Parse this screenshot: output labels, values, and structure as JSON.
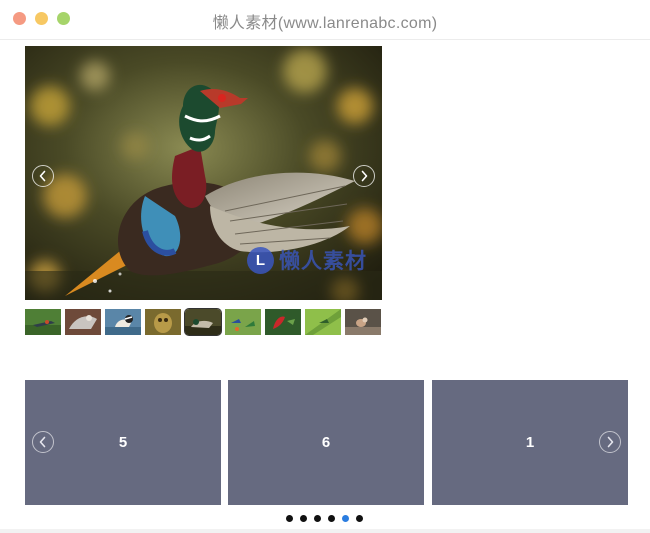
{
  "window": {
    "title": "懒人素材(www.lanrenabc.com)",
    "traffic_colors": [
      "#f59a82",
      "#f7c863",
      "#a6d46a"
    ]
  },
  "gallery": {
    "main_image_icon": "wood-duck-photo",
    "watermark_logo": "L",
    "watermark_text": "懒人素材",
    "prev_icon": "chevron-left-icon",
    "next_icon": "chevron-right-icon",
    "thumbnails": [
      {
        "icon": "hummingbird-photo"
      },
      {
        "icon": "hawk-photo"
      },
      {
        "icon": "merganser-photo"
      },
      {
        "icon": "owl-photo"
      },
      {
        "icon": "wood-duck-photo",
        "active": true
      },
      {
        "icon": "hummingbirds-photo"
      },
      {
        "icon": "hummingbird-red-photo"
      },
      {
        "icon": "hummingbird-green-photo"
      },
      {
        "icon": "small-bird-photo"
      }
    ]
  },
  "carousel": {
    "slides": [
      "5",
      "6",
      "1"
    ],
    "slide_color": "#666a80",
    "dot_count": 6,
    "active_dot": 4,
    "active_dot_color": "#2b7de0"
  }
}
